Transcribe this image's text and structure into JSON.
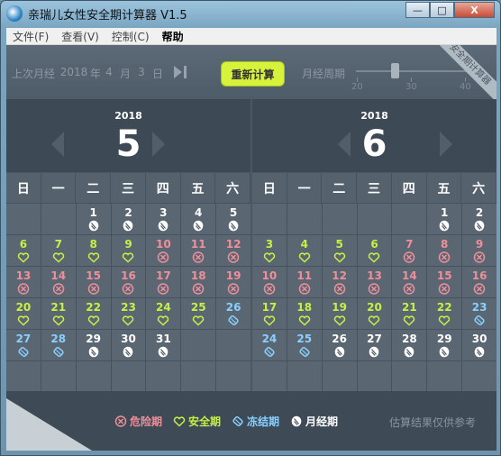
{
  "window": {
    "title": "亲瑞儿女性安全期计算器 V1.5",
    "min": "—",
    "max": "□",
    "close": "X"
  },
  "menu": [
    "文件(F)",
    "查看(V)",
    "控制(C)",
    "帮助"
  ],
  "controls": {
    "last_period_label": "上次月经",
    "year": "2018",
    "year_suffix": "年",
    "month": "4",
    "month_suffix": "月",
    "day": "3",
    "day_suffix": "日",
    "recalc_label": "重新计算",
    "cycle_label": "月经周期",
    "ticks": [
      "20",
      "30",
      "40"
    ],
    "cycle_value_fraction": 0.3,
    "ribbon": "安全期计算器"
  },
  "weekdays": [
    "日",
    "一",
    "二",
    "三",
    "四",
    "五",
    "六"
  ],
  "colors": {
    "danger": "#ef8f9a",
    "safe": "#c9ef46",
    "frozen": "#8ad0ff",
    "period": "#ffffff",
    "bg": "#4a5764"
  },
  "months": [
    {
      "year": "2018",
      "month": "5",
      "days": [
        null,
        null,
        [
          "1",
          "p"
        ],
        [
          "2",
          "p"
        ],
        [
          "3",
          "p"
        ],
        [
          "4",
          "p"
        ],
        [
          "5",
          "p"
        ],
        [
          "6",
          "s"
        ],
        [
          "7",
          "s"
        ],
        [
          "8",
          "s"
        ],
        [
          "9",
          "s"
        ],
        [
          "10",
          "d"
        ],
        [
          "11",
          "d"
        ],
        [
          "12",
          "d"
        ],
        [
          "13",
          "d"
        ],
        [
          "14",
          "d"
        ],
        [
          "15",
          "d"
        ],
        [
          "16",
          "d"
        ],
        [
          "17",
          "d"
        ],
        [
          "18",
          "d"
        ],
        [
          "19",
          "d"
        ],
        [
          "20",
          "s"
        ],
        [
          "21",
          "s"
        ],
        [
          "22",
          "s"
        ],
        [
          "23",
          "s"
        ],
        [
          "24",
          "s"
        ],
        [
          "25",
          "s"
        ],
        [
          "26",
          "f"
        ],
        [
          "27",
          "f"
        ],
        [
          "28",
          "f"
        ],
        [
          "29",
          "p"
        ],
        [
          "30",
          "p"
        ],
        [
          "31",
          "p"
        ],
        null,
        null,
        null,
        null,
        null,
        null,
        null,
        null,
        null
      ]
    },
    {
      "year": "2018",
      "month": "6",
      "days": [
        null,
        null,
        null,
        null,
        null,
        [
          "1",
          "p"
        ],
        [
          "2",
          "p"
        ],
        [
          "3",
          "s"
        ],
        [
          "4",
          "s"
        ],
        [
          "5",
          "s"
        ],
        [
          "6",
          "s"
        ],
        [
          "7",
          "d"
        ],
        [
          "8",
          "d"
        ],
        [
          "9",
          "d"
        ],
        [
          "10",
          "d"
        ],
        [
          "11",
          "d"
        ],
        [
          "12",
          "d"
        ],
        [
          "13",
          "d"
        ],
        [
          "14",
          "d"
        ],
        [
          "15",
          "d"
        ],
        [
          "16",
          "d"
        ],
        [
          "17",
          "s"
        ],
        [
          "18",
          "s"
        ],
        [
          "19",
          "s"
        ],
        [
          "20",
          "s"
        ],
        [
          "21",
          "s"
        ],
        [
          "22",
          "s"
        ],
        [
          "23",
          "f"
        ],
        [
          "24",
          "f"
        ],
        [
          "25",
          "f"
        ],
        [
          "26",
          "p"
        ],
        [
          "27",
          "p"
        ],
        [
          "28",
          "p"
        ],
        [
          "29",
          "p"
        ],
        [
          "30",
          "p"
        ],
        null,
        null,
        null,
        null,
        null,
        null,
        null
      ]
    }
  ],
  "legend": [
    {
      "type": "d",
      "label": "危险期",
      "icon": "danger-icon"
    },
    {
      "type": "s",
      "label": "安全期",
      "icon": "heart-icon"
    },
    {
      "type": "f",
      "label": "冻结期",
      "icon": "frozen-icon"
    },
    {
      "type": "p",
      "label": "月经期",
      "icon": "period-icon"
    }
  ],
  "disclaimer": "估算结果仅供参考"
}
